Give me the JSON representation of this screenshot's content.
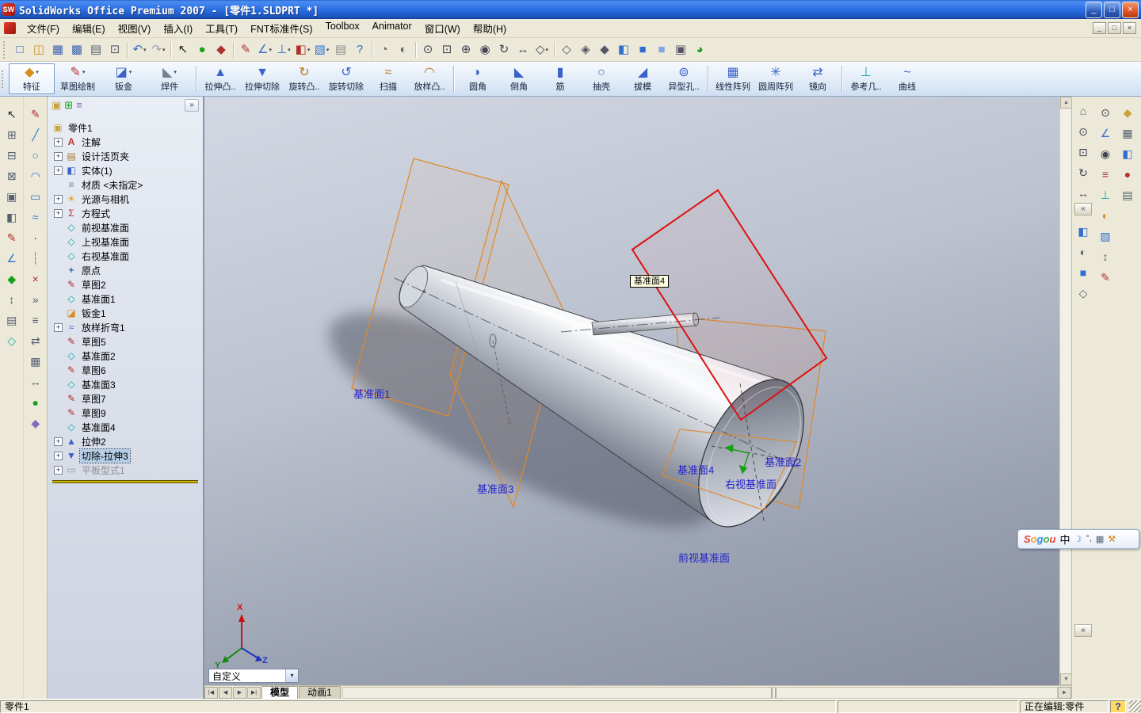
{
  "window": {
    "title": "SolidWorks Office Premium 2007 - [零件1.SLDPRT *]",
    "logo_text": "SW",
    "minimize": "_",
    "restore": "□",
    "close": "×"
  },
  "menu": {
    "items": [
      {
        "label": "文件(F)"
      },
      {
        "label": "编辑(E)"
      },
      {
        "label": "视图(V)"
      },
      {
        "label": "插入(I)"
      },
      {
        "label": "工具(T)"
      },
      {
        "label": "FNT标准件(S)"
      },
      {
        "label": "Toolbox"
      },
      {
        "label": "Animator"
      },
      {
        "label": "窗口(W)"
      },
      {
        "label": "帮助(H)"
      }
    ],
    "mdi": {
      "minimize": "_",
      "restore": "□",
      "close": "×"
    }
  },
  "std_toolbar": {
    "icons": [
      {
        "n": "new-document-icon",
        "g": "□",
        "c": "#3a62b0"
      },
      {
        "n": "open-document-icon",
        "g": "◫",
        "c": "#c8922a"
      },
      {
        "n": "save-icon",
        "g": "▦",
        "c": "#3a62b0"
      },
      {
        "n": "save-all-icon",
        "g": "▩",
        "c": "#3a62b0"
      },
      {
        "n": "print-icon",
        "g": "▤",
        "c": "#55606e"
      },
      {
        "n": "print-preview-icon",
        "g": "⊡",
        "c": "#55606e"
      },
      {
        "n": "toolbar-separator",
        "cls": "sep"
      },
      {
        "n": "undo-icon",
        "g": "↶",
        "c": "#2f6fd0",
        "dd": "▾"
      },
      {
        "n": "redo-icon",
        "g": "↷",
        "c": "#9aa4b4",
        "dd": "▾"
      },
      {
        "n": "toolbar-separator",
        "cls": "sep"
      },
      {
        "n": "select-icon",
        "g": "↖",
        "c": "#222222"
      },
      {
        "n": "rebuild-icon",
        "g": "●",
        "c": "#18a018"
      },
      {
        "n": "options-icon",
        "g": "◆",
        "c": "#b03030"
      },
      {
        "n": "toolbar-separator",
        "cls": "sep"
      },
      {
        "n": "sketch-icon",
        "g": "✎",
        "c": "#b03030"
      },
      {
        "n": "dimension-icon",
        "g": "∠",
        "c": "#2f6fd0",
        "dd": "▾"
      },
      {
        "n": "relations-icon",
        "g": "⊥",
        "c": "#2f6fd0",
        "dd": "▾"
      },
      {
        "n": "part-cube-icon",
        "g": "◧",
        "c": "#b03030",
        "dd": "▾"
      },
      {
        "n": "assembly-icon",
        "g": "▧",
        "c": "#2f6fd0",
        "dd": "▾"
      },
      {
        "n": "drawing-sheet-icon",
        "g": "▤",
        "c": "#888888"
      },
      {
        "n": "help-icon",
        "g": "?",
        "c": "#2f6fd0"
      },
      {
        "n": "toolbar-separator",
        "cls": "sep"
      },
      {
        "n": "edrawings-icon",
        "g": "◔",
        "c": "#666666"
      },
      {
        "n": "photoworks-icon",
        "g": "◐",
        "c": "#666666"
      },
      {
        "n": "toolbar-separator",
        "cls": "sep"
      },
      {
        "n": "zoom-to-fit-icon",
        "g": "⊙",
        "c": "#444455"
      },
      {
        "n": "zoom-to-area-icon",
        "g": "⊡",
        "c": "#444455"
      },
      {
        "n": "zoom-in-out-icon",
        "g": "⊕",
        "c": "#444455"
      },
      {
        "n": "zoom-to-selection-icon",
        "g": "◉",
        "c": "#444455"
      },
      {
        "n": "rotate-view-icon",
        "g": "↻",
        "c": "#444455"
      },
      {
        "n": "pan-icon",
        "g": "↔",
        "c": "#444455"
      },
      {
        "n": "3d-drawing-view-icon",
        "g": "◇",
        "c": "#444455",
        "dd": "▾"
      },
      {
        "n": "toolbar-separator",
        "cls": "sep"
      },
      {
        "n": "wireframe-icon",
        "g": "◇",
        "c": "#555566"
      },
      {
        "n": "hidden-lines-visible-icon",
        "g": "◈",
        "c": "#555566"
      },
      {
        "n": "hidden-lines-removed-icon",
        "g": "◆",
        "c": "#555566"
      },
      {
        "n": "section-view-icon",
        "g": "◧",
        "c": "#2f6fd0"
      },
      {
        "n": "shaded-with-edges-icon",
        "g": "■",
        "c": "#2f6fd0"
      },
      {
        "n": "shaded-icon",
        "g": "■",
        "c": "#7fa8e0"
      },
      {
        "n": "shadows-icon",
        "g": "▣",
        "c": "#555566"
      },
      {
        "n": "curvature-icon",
        "g": "◕",
        "c": "#18a018"
      }
    ]
  },
  "command_manager": {
    "items": [
      {
        "label": "特征",
        "g": "◆",
        "c": "#d88c1e",
        "dd": "▾",
        "cls": "cm-tab active",
        "n": "tab-features"
      },
      {
        "label": "草图绘制",
        "g": "✎",
        "c": "#c03030",
        "dd": "▾",
        "cls": "cm-tab",
        "n": "tab-sketch"
      },
      {
        "label": "钣金",
        "g": "◪",
        "c": "#3a62c8",
        "dd": "▾",
        "cls": "cm-tab",
        "n": "tab-sheet-metal"
      },
      {
        "label": "焊件",
        "g": "◣",
        "c": "#77808e",
        "dd": "▾",
        "cls": "cm-tab",
        "n": "tab-weldments"
      },
      {
        "cls": "cm-div",
        "n": "cm-divider"
      },
      {
        "label": "拉伸凸..",
        "g": "▲",
        "c": "#3a62c8",
        "n": "extrude-boss-button"
      },
      {
        "label": "拉伸切除",
        "g": "▼",
        "c": "#3a62c8",
        "n": "extrude-cut-button"
      },
      {
        "label": "旋转凸..",
        "g": "↻",
        "c": "#c07818",
        "n": "revolve-boss-button"
      },
      {
        "label": "旋转切除",
        "g": "↺",
        "c": "#3a62c8",
        "n": "revolve-cut-button"
      },
      {
        "label": "扫描",
        "g": "≈",
        "c": "#c07818",
        "n": "sweep-button"
      },
      {
        "label": "放样凸..",
        "g": "◠",
        "c": "#c07818",
        "n": "loft-boss-button"
      },
      {
        "cls": "cm-div",
        "n": "cm-divider"
      },
      {
        "label": "圆角",
        "g": "◗",
        "c": "#3a62c8",
        "n": "fillet-button"
      },
      {
        "label": "倒角",
        "g": "◣",
        "c": "#3a62c8",
        "n": "chamfer-button"
      },
      {
        "label": "筋",
        "g": "▮",
        "c": "#3a62c8",
        "n": "rib-button"
      },
      {
        "label": "抽壳",
        "g": "○",
        "c": "#3a62c8",
        "n": "shell-button"
      },
      {
        "label": "拔模",
        "g": "◢",
        "c": "#3a62c8",
        "n": "draft-button"
      },
      {
        "label": "异型孔..",
        "g": "⊚",
        "c": "#3a62c8",
        "n": "hole-wizard-button"
      },
      {
        "cls": "cm-div",
        "n": "cm-divider"
      },
      {
        "label": "线性阵列",
        "g": "▦",
        "c": "#3a62c8",
        "n": "linear-pattern-button"
      },
      {
        "label": "圆周阵列",
        "g": "✳",
        "c": "#3a62c8",
        "n": "circular-pattern-button"
      },
      {
        "label": "镜向",
        "g": "⇄",
        "c": "#3a62c8",
        "n": "mirror-button"
      },
      {
        "cls": "cm-div",
        "n": "cm-divider"
      },
      {
        "label": "参考几..",
        "g": "⊥",
        "c": "#18a8a8",
        "n": "reference-geometry-button"
      },
      {
        "label": "曲线",
        "g": "~",
        "c": "#3a62c8",
        "n": "curves-button"
      }
    ]
  },
  "left_toolbar_a": {
    "icons": [
      {
        "n": "select-tool-icon",
        "g": "↖",
        "c": "#222222"
      },
      {
        "n": "box-select-icon",
        "g": "⊞",
        "c": "#556070"
      },
      {
        "n": "lasso-icon",
        "g": "⊟",
        "c": "#556070"
      },
      {
        "n": "filter-icon",
        "g": "⊠",
        "c": "#556070"
      },
      {
        "n": "feature-icon",
        "g": "▣",
        "c": "#556070"
      },
      {
        "n": "surface-icon",
        "g": "◧",
        "c": "#556070"
      },
      {
        "n": "sketch-tool-icon",
        "g": "✎",
        "c": "#b03030"
      },
      {
        "n": "dimension-tool-icon",
        "g": "∠",
        "c": "#2f6fd0"
      },
      {
        "n": "relation-tool-icon",
        "g": "◆",
        "c": "#18a018"
      },
      {
        "n": "move-tool-icon",
        "g": "↕",
        "c": "#556070"
      },
      {
        "n": "table-tool-icon",
        "g": "▤",
        "c": "#556070"
      },
      {
        "n": "plane-tool-icon",
        "g": "◇",
        "c": "#18a8a8"
      }
    ]
  },
  "left_toolbar_b": {
    "icons": [
      {
        "n": "sketch-icon",
        "g": "✎",
        "c": "#b03030"
      },
      {
        "n": "line-icon",
        "g": "╱",
        "c": "#2f6fd0"
      },
      {
        "n": "circle-icon",
        "g": "○",
        "c": "#2f6fd0"
      },
      {
        "n": "arc-icon",
        "g": "◠",
        "c": "#2f6fd0"
      },
      {
        "n": "rectangle-icon",
        "g": "▭",
        "c": "#2f6fd0"
      },
      {
        "n": "spline-icon",
        "g": "≈",
        "c": "#2f6fd0"
      },
      {
        "n": "point-icon",
        "g": "·",
        "c": "#222222"
      },
      {
        "n": "centerline-icon",
        "g": "┆",
        "c": "#888888"
      },
      {
        "n": "trim-icon",
        "g": "×",
        "c": "#b03030"
      },
      {
        "n": "convert-entities-icon",
        "g": "»",
        "c": "#556070"
      },
      {
        "n": "offset-entities-icon",
        "g": "≡",
        "c": "#556070"
      },
      {
        "n": "mirror-entities-icon",
        "g": "⇄",
        "c": "#556070"
      },
      {
        "n": "linear-sketch-pattern-icon",
        "g": "▦",
        "c": "#556070"
      },
      {
        "n": "move-entities-icon",
        "g": "↔",
        "c": "#556070"
      },
      {
        "n": "display-relations-icon",
        "g": "●",
        "c": "#18a018"
      },
      {
        "n": "quick-snaps-icon",
        "g": "◆",
        "c": "#8868c0"
      }
    ]
  },
  "tree": {
    "header_icons": [
      {
        "n": "featuremanager-tab-icon",
        "g": "▣",
        "c": "#c8a23c"
      },
      {
        "n": "propertymanager-tab-icon",
        "g": "⊞",
        "c": "#18a018"
      },
      {
        "n": "configurationmanager-tab-icon",
        "g": "≡",
        "c": "#8868c0"
      }
    ],
    "chevron": "»",
    "items": [
      {
        "label": "零件1",
        "box": "",
        "iconcls": "ticon ic-part",
        "icon": "part-icon",
        "n": "tree-item-part-root",
        "cls": "root"
      },
      {
        "label": "注解",
        "box": "+",
        "iconcls": "ticon ic-ann",
        "icon": "annotations-icon",
        "n": "tree-item-annotations"
      },
      {
        "label": "设计活页夹",
        "box": "+",
        "iconcls": "ticon ic-binder",
        "icon": "design-binder-icon",
        "n": "tree-item-design-binder"
      },
      {
        "label": "实体(1)",
        "box": "+",
        "iconcls": "ticon ic-solids",
        "icon": "solid-bodies-icon",
        "n": "tree-item-solid-bodies"
      },
      {
        "label": "材质 <未指定>",
        "box": "",
        "iconcls": "ticon ic-material",
        "icon": "material-icon",
        "n": "tree-item-material"
      },
      {
        "label": "光源与相机",
        "box": "+",
        "iconcls": "ticon ic-lights",
        "icon": "lights-cameras-icon",
        "n": "tree-item-lights-cameras"
      },
      {
        "label": "方程式",
        "box": "+",
        "iconcls": "ticon ic-eq",
        "icon": "equations-icon",
        "n": "tree-item-equations"
      },
      {
        "label": "前视基准面",
        "box": "",
        "iconcls": "ticon ic-plane",
        "icon": "plane-icon",
        "n": "tree-item-front-plane"
      },
      {
        "label": "上视基准面",
        "box": "",
        "iconcls": "ticon ic-plane",
        "icon": "plane-icon",
        "n": "tree-item-top-plane"
      },
      {
        "label": "右视基准面",
        "box": "",
        "iconcls": "ticon ic-plane",
        "icon": "plane-icon",
        "n": "tree-item-right-plane"
      },
      {
        "label": "原点",
        "box": "",
        "iconcls": "ticon ic-origin",
        "icon": "origin-icon",
        "n": "tree-item-origin"
      },
      {
        "label": "草图2",
        "box": "",
        "iconcls": "ticon ic-sketch",
        "icon": "sketch-icon",
        "n": "tree-item-sketch2"
      },
      {
        "label": "基准面1",
        "box": "",
        "iconcls": "ticon ic-plane",
        "icon": "plane-icon",
        "n": "tree-item-plane1"
      },
      {
        "label": "钣金1",
        "box": "",
        "iconcls": "ticon ic-sheetmetal",
        "icon": "sheet-metal-icon",
        "n": "tree-item-sheetmetal1"
      },
      {
        "label": "放样折弯1",
        "box": "+",
        "iconcls": "ticon ic-loftbend",
        "icon": "lofted-bend-icon",
        "n": "tree-item-lofted-bend1"
      },
      {
        "label": "草图5",
        "box": "",
        "iconcls": "ticon ic-sketch",
        "icon": "sketch-icon",
        "n": "tree-item-sketch5"
      },
      {
        "label": "基准面2",
        "box": "",
        "iconcls": "ticon ic-plane",
        "icon": "plane-icon",
        "n": "tree-item-plane2"
      },
      {
        "label": "草图6",
        "box": "",
        "iconcls": "ticon ic-sketch",
        "icon": "sketch-icon",
        "n": "tree-item-sketch6"
      },
      {
        "label": "基准面3",
        "box": "",
        "iconcls": "ticon ic-plane",
        "icon": "plane-icon",
        "n": "tree-item-plane3"
      },
      {
        "label": "草图7",
        "box": "",
        "iconcls": "ticon ic-sketch",
        "icon": "sketch-icon",
        "n": "tree-item-sketch7"
      },
      {
        "label": "草图9",
        "box": "",
        "iconcls": "ticon ic-sketch",
        "icon": "sketch-icon",
        "n": "tree-item-sketch9"
      },
      {
        "label": "基准面4",
        "box": "",
        "iconcls": "ticon ic-plane",
        "icon": "plane-icon",
        "n": "tree-item-plane4"
      },
      {
        "label": "拉伸2",
        "box": "+",
        "iconcls": "ticon ic-extrude",
        "icon": "extrude-icon",
        "n": "tree-item-extrude2"
      },
      {
        "label": "切除-拉伸3",
        "box": "+",
        "iconcls": "ticon ic-cut",
        "icon": "cut-extrude-icon",
        "n": "tree-item-cut-extrude3",
        "cls": "selected"
      },
      {
        "label": "平板型式1",
        "box": "+",
        "iconcls": "ticon ic-flat",
        "icon": "flat-pattern-icon",
        "n": "tree-item-flat-pattern1",
        "cls": "suppressed"
      }
    ]
  },
  "viewport": {
    "tooltip": "基准面4",
    "plane1_label": "基准面1",
    "plane2_label": "基准面2",
    "plane3_label": "基准面3",
    "plane4_label": "基准面4",
    "right_plane_label": "右视基准面",
    "front_plane_label": "前视基准面",
    "axis_x": "X",
    "axis_y": "Y",
    "axis_z": "Z",
    "selected_plane_color": "#dd1111",
    "reference_plane_color": "#e0882a",
    "label_color": "#2222cc"
  },
  "right_toolbars": {
    "collapse": "«",
    "col1a": [
      {
        "n": "view-orientation-icon",
        "g": "⌂",
        "c": "#556070"
      },
      {
        "n": "zoom-to-fit-icon",
        "g": "⊙",
        "c": "#444455"
      },
      {
        "n": "zoom-to-area-icon",
        "g": "⊡",
        "c": "#444455"
      },
      {
        "n": "rotate-view-icon",
        "g": "↻",
        "c": "#444455"
      },
      {
        "n": "pan-icon",
        "g": "↔",
        "c": "#444455"
      }
    ],
    "col1b": [
      {
        "n": "section-view-icon",
        "g": "◧",
        "c": "#2f6fd0"
      },
      {
        "n": "perspective-icon",
        "g": "◐",
        "c": "#666666"
      },
      {
        "n": "shaded-icon",
        "g": "■",
        "c": "#2f6fd0"
      },
      {
        "n": "wireframe-icon",
        "g": "◇",
        "c": "#556070"
      }
    ],
    "col2": [
      {
        "n": "measure-icon",
        "g": "⊙",
        "c": "#444455"
      },
      {
        "n": "angle-icon",
        "g": "∠",
        "c": "#2f6fd0"
      },
      {
        "n": "mass-properties-icon",
        "g": "◉",
        "c": "#444455"
      },
      {
        "n": "equations-icon",
        "g": "≡",
        "c": "#b03030"
      },
      {
        "n": "reference-geometry-icon",
        "g": "⊥",
        "c": "#18a8a8"
      },
      {
        "n": "appearance-icon",
        "g": "◐",
        "c": "#c8922a"
      },
      {
        "n": "texture-icon",
        "g": "▧",
        "c": "#2f6fd0"
      },
      {
        "n": "move-icon",
        "g": "↕",
        "c": "#556070"
      },
      {
        "n": "annotate-icon",
        "g": "✎",
        "c": "#b03030"
      }
    ],
    "col3": [
      {
        "n": "feature-palette-icon",
        "g": "◆",
        "c": "#c8a23c"
      },
      {
        "n": "design-library-icon",
        "g": "▦",
        "c": "#556070"
      },
      {
        "n": "file-explorer-icon",
        "g": "◧",
        "c": "#2f6fd0"
      },
      {
        "n": "search-icon",
        "g": "●",
        "c": "#b03030"
      },
      {
        "n": "task-pane-icon",
        "g": "▤",
        "c": "#556070"
      }
    ]
  },
  "bottom": {
    "combo_value": "自定义",
    "combo_arrow": "▾",
    "nav": [
      {
        "n": "tab-first-button",
        "g": "|◀"
      },
      {
        "n": "tab-prev-button",
        "g": "◀"
      },
      {
        "n": "tab-next-button",
        "g": "▶"
      },
      {
        "n": "tab-last-button",
        "g": "▶|"
      }
    ],
    "tabs": [
      {
        "label": "模型",
        "cls": "active",
        "n": "tab-model"
      },
      {
        "label": "动画1",
        "n": "tab-animation1"
      }
    ],
    "right_arrow": "►"
  },
  "status": {
    "left": "零件1",
    "editing": "正在编辑:零件",
    "help": "?"
  },
  "sogou": {
    "letters": [
      {
        "ch": "S",
        "c": "#e8413c"
      },
      {
        "ch": "o",
        "c": "#f5a623"
      },
      {
        "ch": "g",
        "c": "#3f8ce8"
      },
      {
        "ch": "o",
        "c": "#46b152"
      },
      {
        "ch": "u",
        "c": "#e8413c"
      }
    ],
    "mode": "中",
    "icons": [
      {
        "n": "fullwidth-halfwidth-icon",
        "g": "☽",
        "c": "#2f6fd0"
      },
      {
        "n": "punctuation-icon",
        "g": "°,",
        "c": "#555555"
      },
      {
        "n": "soft-keyboard-icon",
        "g": "▦",
        "c": "#556070"
      },
      {
        "n": "settings-wrench-icon",
        "g": "⚒",
        "c": "#d08018"
      }
    ]
  }
}
